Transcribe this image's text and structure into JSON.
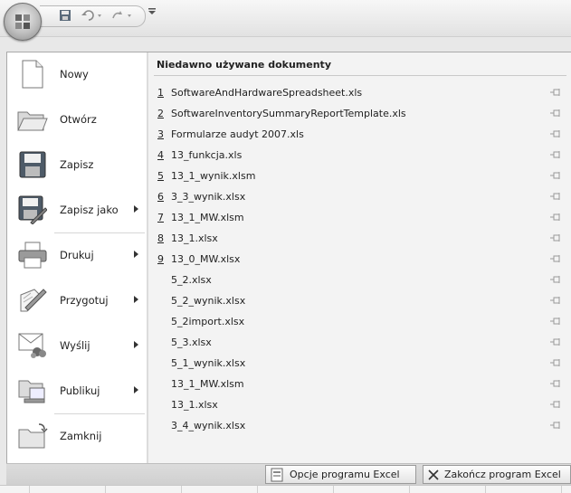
{
  "qat": {
    "save_icon": "save-icon",
    "undo_icon": "undo-icon",
    "redo_icon": "redo-icon",
    "customize_icon": "customize-qat-icon"
  },
  "menu": {
    "items": [
      {
        "label": "Nowy",
        "icon": "new-document-icon",
        "submenu": false
      },
      {
        "label": "Otwórz",
        "icon": "open-folder-icon",
        "submenu": false
      },
      {
        "label": "Zapisz",
        "icon": "save-icon",
        "submenu": false
      },
      {
        "label": "Zapisz jako",
        "icon": "save-as-icon",
        "submenu": true
      },
      {
        "label": "Drukuj",
        "icon": "printer-icon",
        "submenu": true
      },
      {
        "label": "Przygotuj",
        "icon": "prepare-icon",
        "submenu": true
      },
      {
        "label": "Wyślij",
        "icon": "send-icon",
        "submenu": true
      },
      {
        "label": "Publikuj",
        "icon": "publish-icon",
        "submenu": true
      },
      {
        "label": "Zamknij",
        "icon": "close-folder-icon",
        "submenu": false
      }
    ]
  },
  "recent": {
    "title": "Niedawno używane dokumenty",
    "items": [
      {
        "num": "1",
        "name": "SoftwareAndHardwareSpreadsheet.xls"
      },
      {
        "num": "2",
        "name": "SoftwareInventorySummaryReportTemplate.xls"
      },
      {
        "num": "3",
        "name": "Formularze audyt 2007.xls"
      },
      {
        "num": "4",
        "name": "13_funkcja.xls"
      },
      {
        "num": "5",
        "name": "13_1_wynik.xlsm"
      },
      {
        "num": "6",
        "name": "3_3_wynik.xlsx"
      },
      {
        "num": "7",
        "name": "13_1_MW.xlsm"
      },
      {
        "num": "8",
        "name": "13_1.xlsx"
      },
      {
        "num": "9",
        "name": "13_0_MW.xlsx"
      },
      {
        "num": "",
        "name": "5_2.xlsx"
      },
      {
        "num": "",
        "name": "5_2_wynik.xlsx"
      },
      {
        "num": "",
        "name": "5_2import.xlsx"
      },
      {
        "num": "",
        "name": "5_3.xlsx"
      },
      {
        "num": "",
        "name": "5_1_wynik.xlsx"
      },
      {
        "num": "",
        "name": "13_1_MW.xlsm"
      },
      {
        "num": "",
        "name": "13_1.xlsx"
      },
      {
        "num": "",
        "name": "3_4_wynik.xlsx"
      }
    ]
  },
  "bottom": {
    "options_label": "Opcje programu Excel",
    "exit_label": "Zakończ program Excel"
  }
}
